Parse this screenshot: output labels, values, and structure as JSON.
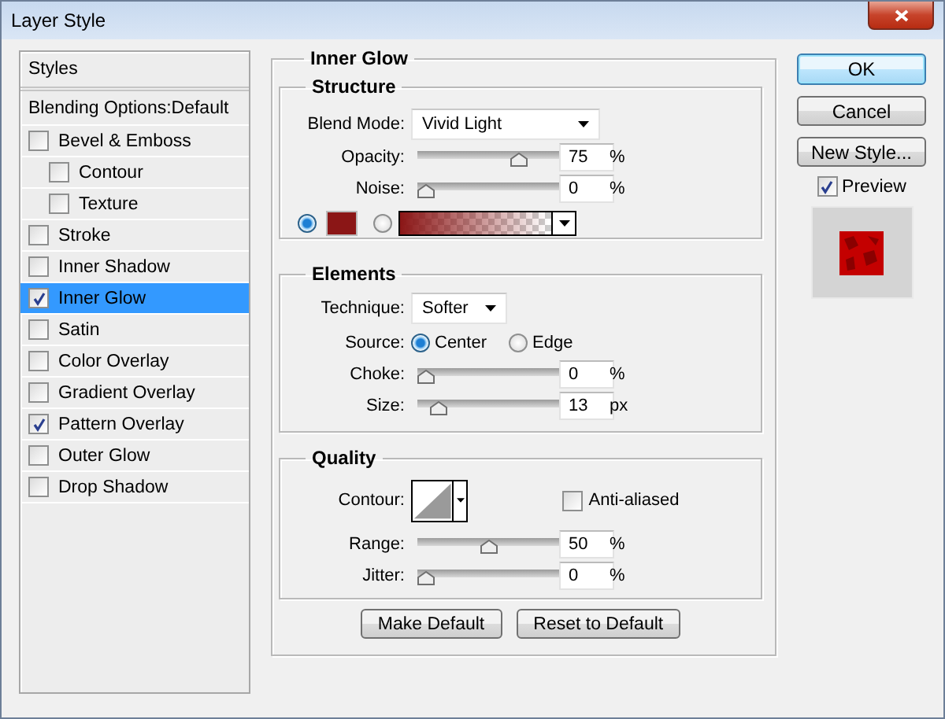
{
  "window": {
    "title": "Layer Style"
  },
  "styles_panel": {
    "header": "Styles",
    "blending_options": "Blending Options:Default",
    "items": [
      {
        "label": "Bevel & Emboss",
        "checked": false,
        "selected": false,
        "children": [
          {
            "label": "Contour",
            "checked": false,
            "selected": false
          },
          {
            "label": "Texture",
            "checked": false,
            "selected": false
          }
        ]
      },
      {
        "label": "Stroke",
        "checked": false,
        "selected": false
      },
      {
        "label": "Inner Shadow",
        "checked": false,
        "selected": false
      },
      {
        "label": "Inner Glow",
        "checked": true,
        "selected": true
      },
      {
        "label": "Satin",
        "checked": false,
        "selected": false
      },
      {
        "label": "Color Overlay",
        "checked": false,
        "selected": false
      },
      {
        "label": "Gradient Overlay",
        "checked": false,
        "selected": false
      },
      {
        "label": "Pattern Overlay",
        "checked": true,
        "selected": false
      },
      {
        "label": "Outer Glow",
        "checked": false,
        "selected": false
      },
      {
        "label": "Drop Shadow",
        "checked": false,
        "selected": false
      }
    ]
  },
  "inner_glow": {
    "title": "Inner Glow",
    "structure": {
      "title": "Structure",
      "blend_mode": {
        "label": "Blend Mode:",
        "value": "Vivid Light"
      },
      "opacity": {
        "label": "Opacity:",
        "level": 0.75,
        "value": "75",
        "unit": "%"
      },
      "noise": {
        "label": "Noise:",
        "level": 0,
        "value": "0",
        "unit": "%"
      },
      "fill_options": [
        {
          "kind": "color",
          "selected": true
        },
        {
          "kind": "gradient",
          "selected": false
        }
      ]
    },
    "elements": {
      "title": "Elements",
      "technique": {
        "label": "Technique:",
        "value": "Softer"
      },
      "source": {
        "label": "Source:",
        "options": [
          {
            "label": "Center",
            "selected": true
          },
          {
            "label": "Edge",
            "selected": false
          }
        ]
      },
      "choke": {
        "label": "Choke:",
        "level": 0,
        "value": "0",
        "unit": "%"
      },
      "size": {
        "label": "Size:",
        "level": 0.1,
        "value": "13",
        "unit": "px"
      }
    },
    "quality": {
      "title": "Quality",
      "contour": {
        "label": "Contour:"
      },
      "anti_aliased": {
        "label": "Anti-aliased",
        "checked": false
      },
      "range": {
        "label": "Range:",
        "level": 0.5,
        "value": "50",
        "unit": "%"
      },
      "jitter": {
        "label": "Jitter:",
        "level": 0,
        "value": "0",
        "unit": "%"
      }
    },
    "buttons": [
      "Make Default",
      "Reset to Default"
    ]
  },
  "actions": [
    {
      "label": "OK",
      "default": true
    },
    {
      "label": "Cancel",
      "default": false
    },
    {
      "label": "New Style...",
      "default": false
    }
  ],
  "preview": {
    "label": "Preview",
    "checked": true
  }
}
